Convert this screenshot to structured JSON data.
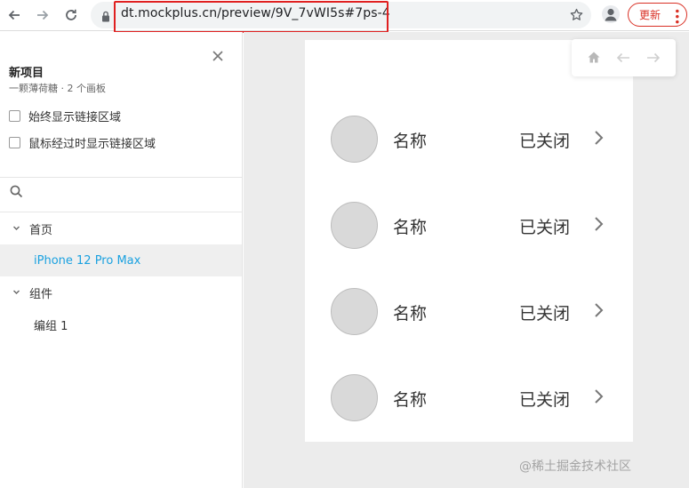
{
  "browser": {
    "url": "dt.mockplus.cn/preview/9V_7vWI5s#7ps-4",
    "update_label": "更新",
    "icons": [
      "back-icon",
      "forward-icon",
      "reload-icon",
      "lock-icon",
      "star-icon",
      "profile-icon",
      "menu-icon"
    ],
    "accent": "#d93025",
    "highlight": "#e02020"
  },
  "sidebar": {
    "project_title": "新项目",
    "project_subtitle": "一颗薄荷糖 · 2 个画板",
    "options": [
      {
        "label": "始终显示链接区域",
        "checked": false
      },
      {
        "label": "鼠标经过时显示链接区域",
        "checked": false
      }
    ],
    "search_placeholder": "",
    "tree": [
      {
        "label": "首页",
        "expanded": true,
        "children": [
          {
            "label": "iPhone 12 Pro Max",
            "active": true
          }
        ]
      },
      {
        "label": "组件",
        "expanded": true,
        "children": [
          {
            "label": "编组 1",
            "active": false
          }
        ]
      }
    ],
    "active_color": "#1aa1e0"
  },
  "artboard": {
    "rows": [
      {
        "name": "名称",
        "status": "已关闭"
      },
      {
        "name": "名称",
        "status": "已关闭"
      },
      {
        "name": "名称",
        "status": "已关闭"
      },
      {
        "name": "名称",
        "status": "已关闭"
      }
    ]
  },
  "watermark": "@稀土掘金技术社区"
}
